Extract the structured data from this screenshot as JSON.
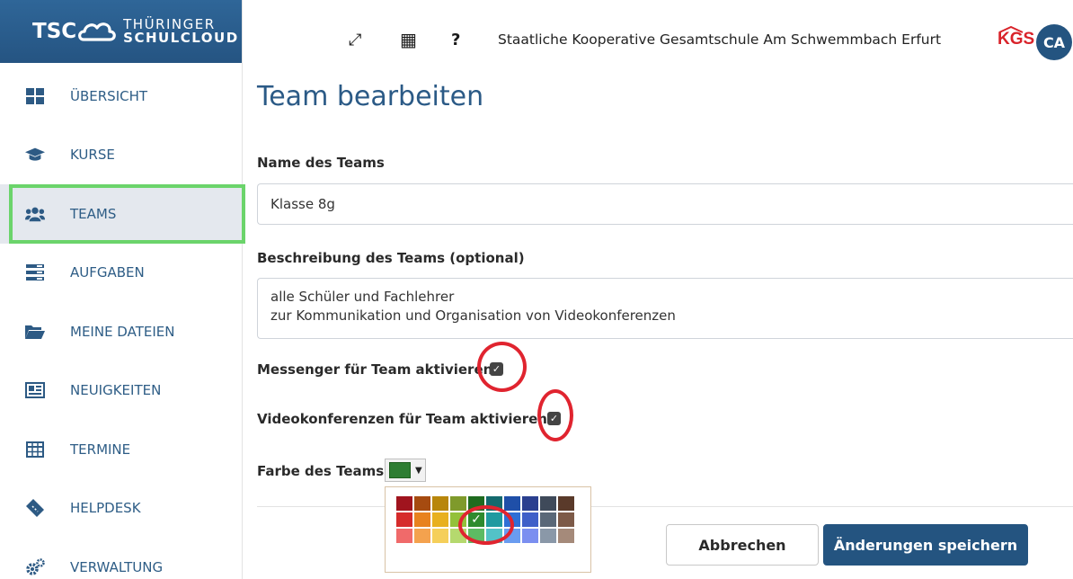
{
  "brand": {
    "abbr": "TSC",
    "line1": "THÜRINGER",
    "line2": "SCHULCLOUD"
  },
  "sidebar": {
    "items": [
      {
        "label": "ÜBERSICHT",
        "icon": "dashboard-icon",
        "active": false
      },
      {
        "label": "KURSE",
        "icon": "graduation-cap-icon",
        "active": false
      },
      {
        "label": "TEAMS",
        "icon": "users-icon",
        "active": true
      },
      {
        "label": "AUFGABEN",
        "icon": "tasks-icon",
        "active": false
      },
      {
        "label": "MEINE DATEIEN",
        "icon": "folder-icon",
        "active": false
      },
      {
        "label": "NEUIGKEITEN",
        "icon": "newspaper-icon",
        "active": false
      },
      {
        "label": "TERMINE",
        "icon": "calendar-table-icon",
        "active": false
      },
      {
        "label": "HELPDESK",
        "icon": "ticket-icon",
        "active": false
      },
      {
        "label": "VERWALTUNG",
        "icon": "cogs-icon",
        "active": false
      }
    ]
  },
  "header": {
    "icons": {
      "fullscreen": "⤢",
      "qr": "▦",
      "help": "?"
    },
    "school_name": "Staatliche Kooperative Gesamtschule Am Schwemmbach Erfurt",
    "school_logo_text": "KGS",
    "avatar_initials": "CA"
  },
  "main": {
    "title": "Team bearbeiten",
    "name_label": "Name des Teams",
    "name_value": "Klasse 8g",
    "desc_label": "Beschreibung des Teams (optional)",
    "desc_value": "alle Schüler und Fachlehrer\nzur Kommunikation und Organisation von Videokonferenzen",
    "messenger_label": "Messenger für Team aktivieren",
    "messenger_checked": true,
    "video_label": "Videokonferenzen für Team aktivieren",
    "video_checked": true,
    "color_label": "Farbe des Teams",
    "selected_color": "#2e7d32",
    "palette": [
      [
        "#a0141e",
        "#a64b10",
        "#b8860b",
        "#7f9a2b",
        "#1f6b1f",
        "#146a6e",
        "#1f4fa8",
        "#2a3f8f",
        "#3f4a5a",
        "#5a3a2a"
      ],
      [
        "#d62b2b",
        "#e8821e",
        "#e8b01e",
        "#93c13a",
        "#2e8b2e",
        "#1f9aa0",
        "#2f6fd6",
        "#3f5fc8",
        "#5a6878",
        "#7d5a48"
      ],
      [
        "#f06a6a",
        "#f4a24e",
        "#f5cf5a",
        "#b5d96e",
        "#5dbb63",
        "#53c2c7",
        "#6a9cf0",
        "#7b8ff0",
        "#8a98a8",
        "#a58a7a"
      ]
    ],
    "selected_swatch_row": 1,
    "selected_swatch_col": 4,
    "cancel_label": "Abbrechen",
    "save_label": "Änderungen speichern"
  },
  "annotation_color": "#e0242f",
  "highlight_color": "#6bd46b"
}
